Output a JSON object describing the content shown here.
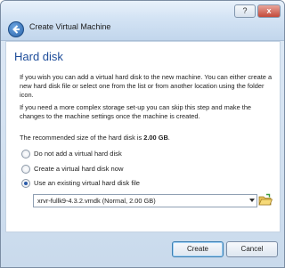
{
  "window": {
    "title": "Create Virtual Machine",
    "help_label": "?",
    "close_label": "x"
  },
  "page": {
    "heading": "Hard disk",
    "paragraph1": "If you wish you can add a virtual hard disk to the new machine. You can either create a new hard disk file or select one from the list or from another location using the folder icon.",
    "paragraph2": "If you need a more complex storage set-up you can skip this step and make the changes to the machine settings once the machine is created.",
    "recommended_prefix": "The recommended size of the hard disk is ",
    "recommended_size": "2.00 GB",
    "recommended_suffix": "."
  },
  "options": [
    {
      "label": "Do not add a virtual hard disk",
      "selected": false
    },
    {
      "label": "Create a virtual hard disk now",
      "selected": false
    },
    {
      "label": "Use an existing virtual hard disk file",
      "selected": true
    }
  ],
  "disk_select": {
    "value": "xrvr-fullk9-4.3.2.vmdk (Normal, 2.00 GB)"
  },
  "buttons": {
    "create": "Create",
    "cancel": "Cancel"
  },
  "icons": {
    "back": "back-arrow-icon",
    "folder": "folder-open-icon"
  }
}
